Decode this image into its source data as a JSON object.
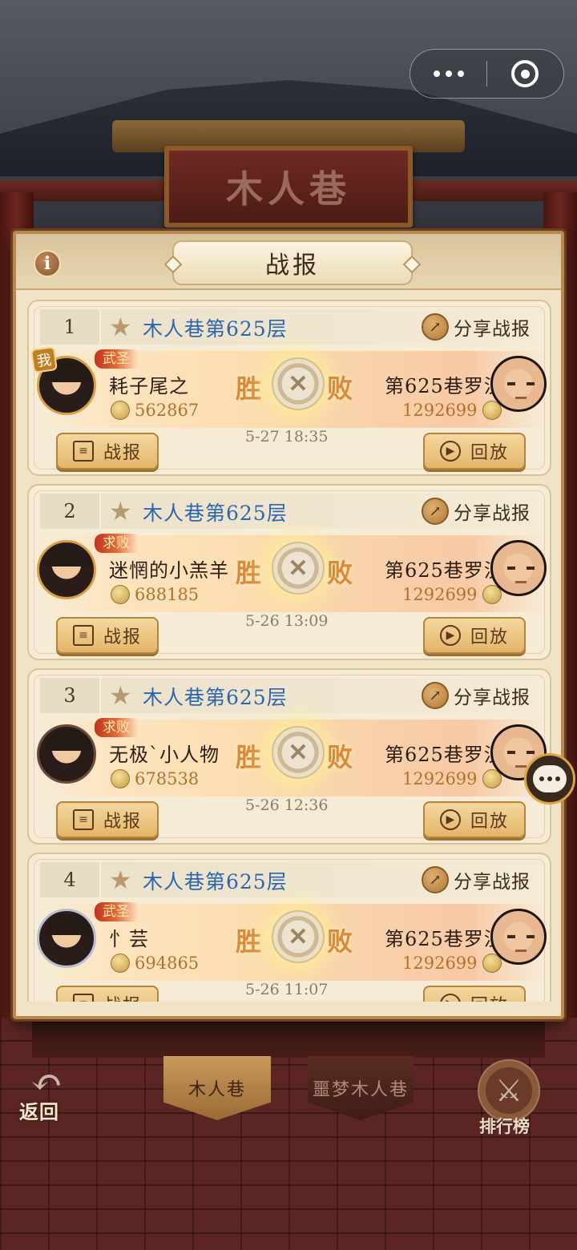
{
  "header": {
    "sign_title": "木人巷"
  },
  "capsule": {
    "more_icon": "more-icon",
    "close_icon": "close-target-icon"
  },
  "panel": {
    "title": "战报",
    "info_icon_glyph": "i"
  },
  "records": [
    {
      "rank": "1",
      "floor_title": "木人巷第625层",
      "share_label": "分享战报",
      "player": {
        "name": "耗子尾之",
        "score": "562867",
        "tag": "武圣",
        "me_badge": "我",
        "frame": "gold"
      },
      "result_left": "胜",
      "result_right": "败",
      "opponent": {
        "name": "第625巷罗汉",
        "score": "1292699"
      },
      "time": "5-27 18:35",
      "report_label": "战报",
      "replay_label": "回放"
    },
    {
      "rank": "2",
      "floor_title": "木人巷第625层",
      "share_label": "分享战报",
      "player": {
        "name": "迷惘的小羔羊",
        "score": "688185",
        "tag": "求败",
        "me_badge": "",
        "frame": "gold"
      },
      "result_left": "胜",
      "result_right": "败",
      "opponent": {
        "name": "第625巷罗汉",
        "score": "1292699"
      },
      "time": "5-26 13:09",
      "report_label": "战报",
      "replay_label": "回放"
    },
    {
      "rank": "3",
      "floor_title": "木人巷第625层",
      "share_label": "分享战报",
      "player": {
        "name": "无极`小人物",
        "score": "678538",
        "tag": "求败",
        "me_badge": "",
        "frame": "dark"
      },
      "result_left": "胜",
      "result_right": "败",
      "opponent": {
        "name": "第625巷罗汉",
        "score": "1292699"
      },
      "time": "5-26 12:36",
      "report_label": "战报",
      "replay_label": "回放"
    },
    {
      "rank": "4",
      "floor_title": "木人巷第625层",
      "share_label": "分享战报",
      "player": {
        "name": "忄芸",
        "score": "694865",
        "tag": "武圣",
        "me_badge": "",
        "frame": "silver"
      },
      "result_left": "胜",
      "result_right": "败",
      "opponent": {
        "name": "第625巷罗汉",
        "score": "1292699"
      },
      "time": "5-26 11:07",
      "report_label": "战报",
      "replay_label": "回放"
    }
  ],
  "bottom_nav": {
    "back_label": "返回",
    "tabs": [
      {
        "label": "木人巷",
        "active": true
      },
      {
        "label": "噩梦木人巷",
        "active": false
      }
    ],
    "rank_label": "排行榜"
  },
  "colors": {
    "floor_title": "#2c66b0",
    "score": "#b2722a",
    "result": "#d9893a",
    "panel_bg": "#f1e3c5"
  }
}
